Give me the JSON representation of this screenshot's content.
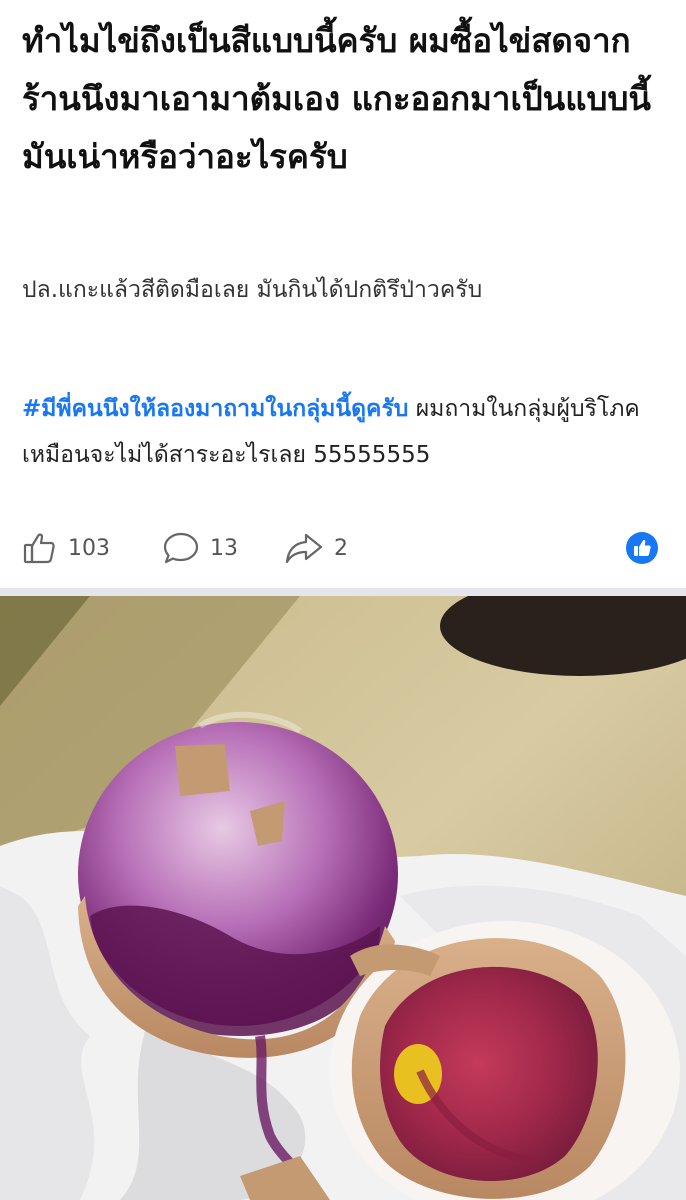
{
  "post": {
    "title": "ทำไมไข่ถึงเป็นสีแบบนี้ครับ ผมซื้อไข่สดจากร้านนึงมาเอามาต้มเอง แกะออกมาเป็นแบบนี้ มันเน่าหรือว่าอะไรครับ",
    "subtitle": "ปล.แกะแล้วสีติดมือเลย มันกินได้ปกติรึป่าวครับ",
    "hashtag": "#มีพี่คนนึงให้ลองมาถามในกลุ่มนี้ดูครับ",
    "body_text": " ผมถามในกลุ่มผู้บริโภคเหมือนจะไม่ได้สาระอะไรเลย 55555555"
  },
  "actions": {
    "like_count": "103",
    "comment_count": "13",
    "share_count": "2"
  },
  "icons": {
    "like": "thumbs-up-icon",
    "comment": "speech-bubble-icon",
    "share": "share-arrow-icon",
    "reaction": "like-reaction-icon"
  },
  "colors": {
    "accent": "#1877f2",
    "divider": "#e4e6eb"
  }
}
